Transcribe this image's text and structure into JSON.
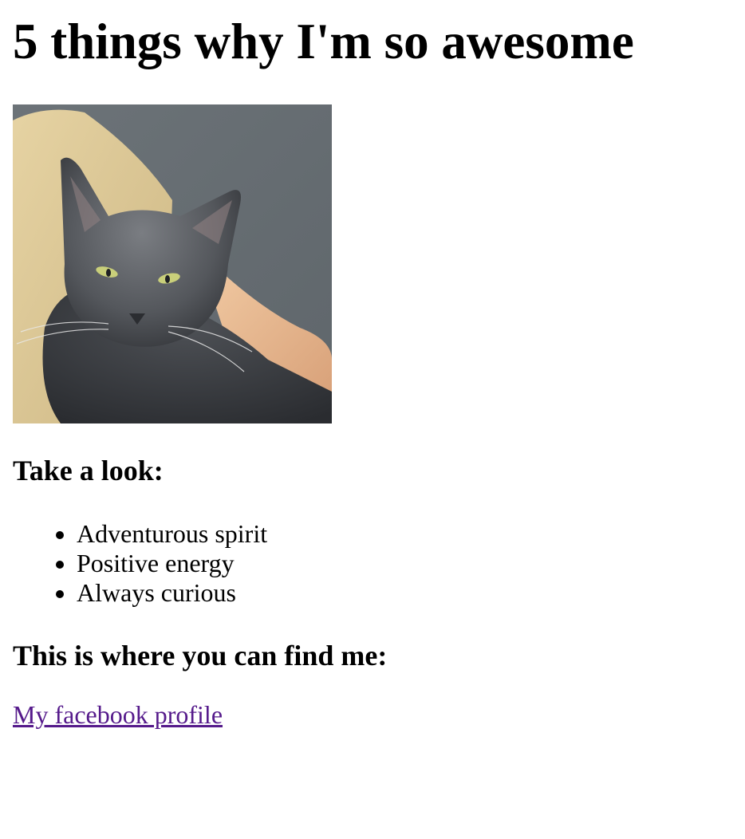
{
  "page": {
    "title": "5 things why I'm so awesome",
    "photo_name": "cat-photo",
    "section_look": "Take a look:",
    "traits": [
      "Adventurous spirit",
      "Positive energy",
      "Always curious"
    ],
    "section_find": "This is where you can find me:",
    "link_label": "My facebook profile"
  },
  "colors": {
    "link_visited": "#551a8b",
    "text": "#000000",
    "background": "#ffffff"
  }
}
